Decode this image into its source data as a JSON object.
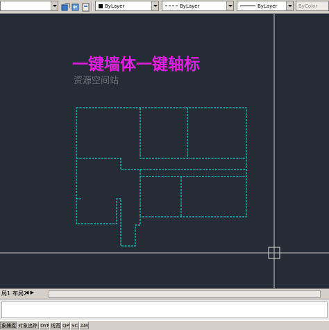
{
  "toolbar": {
    "color_control": "ByLayer",
    "linetype_control": "ByLayer",
    "lineweight_control": "ByLayer",
    "plotstyle_control": "ByColor"
  },
  "drawing": {
    "title": "一键墙体一键轴标",
    "watermark": "资源空间站",
    "colors": {
      "background": "#262c35",
      "wall_lines": "#1ec8c8",
      "crosshair": "#c8c8c8",
      "title": "#e21ee2"
    }
  },
  "tabs": {
    "layout1": "局1",
    "layout2": "布局2"
  },
  "statusbar": {
    "snap": "象捕捉",
    "osnap": "对象追踪",
    "dyn": "DYN",
    "lwt": "线宽",
    "qp": "QP",
    "sc": "SC",
    "am": "AM"
  }
}
